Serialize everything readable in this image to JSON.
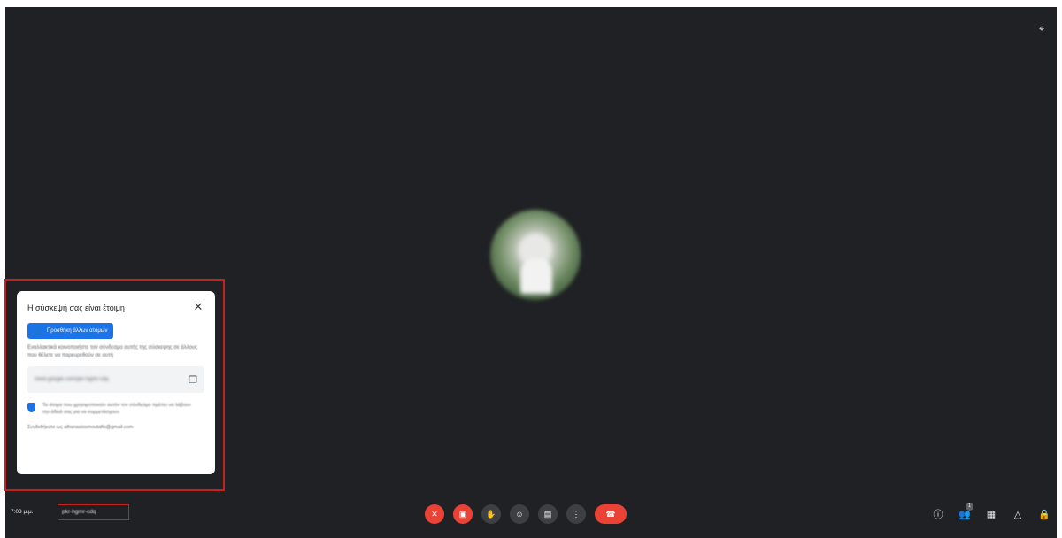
{
  "meeting": {
    "time": "7:03 μ.μ.",
    "code": "pkr-hgmr-cdq"
  },
  "panel": {
    "title": "Η σύσκεψή σας είναι έτοιμη",
    "close_icon": "close-icon",
    "add_people_label": "Προσθήκη άλλων ατόμων",
    "description": "Εναλλακτικά κοινοποιήστε τον σύνδεσμο αυτής της σύσκεψης σε άλλους που θέλετε να παρευρεθούν σε αυτή",
    "link": "meet.google.com/pkr-hgmr-cdq",
    "shield_text": "Τα άτομα που χρησιμοποιούν αυτόν τον σύνδεσμο πρέπει να λάβουν την άδειά σας για να συμμετάσχουν.",
    "joined_as": "Συνδεθήκατε ως athanasiosmoutafis@gmail.com"
  },
  "controls": [
    {
      "name": "microphone-off-button",
      "icon": "mic-off-icon",
      "glyph": "✕",
      "style": "red"
    },
    {
      "name": "camera-off-button",
      "icon": "camera-off-icon",
      "glyph": "▣",
      "style": "red"
    },
    {
      "name": "raise-hand-button",
      "icon": "hand-icon",
      "glyph": "✋",
      "style": "dark"
    },
    {
      "name": "reactions-button",
      "icon": "emoji-icon",
      "glyph": "☺",
      "style": "dark"
    },
    {
      "name": "present-button",
      "icon": "present-icon",
      "glyph": "▤",
      "style": "dark"
    },
    {
      "name": "more-options-button",
      "icon": "more-vert-icon",
      "glyph": "⋮",
      "style": "dark"
    },
    {
      "name": "leave-call-button",
      "icon": "phone-end-icon",
      "glyph": "☎",
      "style": "end"
    }
  ],
  "right_tools": [
    {
      "name": "meeting-details-button",
      "icon": "info-icon",
      "glyph": "ⓘ"
    },
    {
      "name": "people-button",
      "icon": "people-icon",
      "glyph": "👥",
      "badge": "1"
    },
    {
      "name": "chat-button",
      "icon": "chat-icon",
      "glyph": "▦"
    },
    {
      "name": "activities-button",
      "icon": "activities-icon",
      "glyph": "△"
    },
    {
      "name": "host-controls-button",
      "icon": "lock-icon",
      "glyph": "🔒"
    }
  ],
  "colors": {
    "background": "#202124",
    "highlight": "#c5221f",
    "accent": "#1a73e8",
    "danger": "#ea4335"
  }
}
